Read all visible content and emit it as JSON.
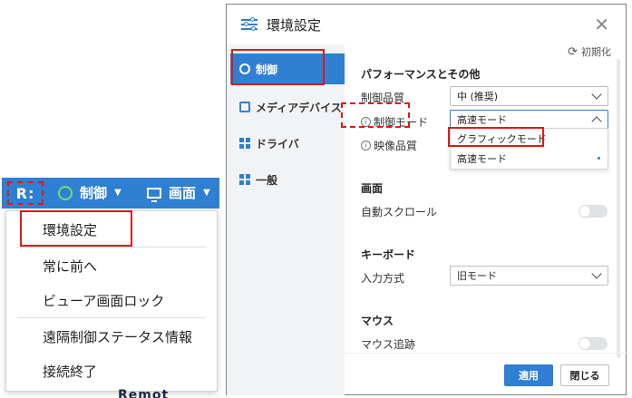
{
  "toolbar": {
    "logo": "R:",
    "control_label": "制御",
    "screen_label": "画面"
  },
  "context_menu": {
    "items": [
      {
        "label": "環境設定"
      },
      {
        "label": "常に前へ"
      },
      {
        "label": "ビューア画面ロック"
      },
      {
        "label": "遠隔制御ステータス情報"
      },
      {
        "label": "接続終了"
      }
    ]
  },
  "background_peek": {
    "prefix": "",
    "text": "Remot"
  },
  "dialog": {
    "title": "環境設定",
    "reset_label": "初期化",
    "sidebar": [
      {
        "label": "制御"
      },
      {
        "label": "メディアデバイス"
      },
      {
        "label": "ドライバ"
      },
      {
        "label": "一般"
      }
    ],
    "sections": {
      "performance": {
        "title": "パフォーマンスとその他",
        "control_quality": {
          "label": "制御品質",
          "value": "中 (推奨)"
        },
        "control_mode": {
          "label": "制御モード",
          "value": "高速モード"
        },
        "video_quality": {
          "label": "映像品質"
        },
        "mode_options": [
          "グラフィックモード",
          "高速モード"
        ]
      },
      "screen": {
        "title": "画面",
        "auto_scroll": {
          "label": "自動スクロール"
        }
      },
      "keyboard": {
        "title": "キーボード",
        "input_method": {
          "label": "入力方式",
          "value": "旧モード"
        }
      },
      "mouse": {
        "title": "マウス",
        "mouse_tracking": {
          "label": "マウス追跡"
        }
      }
    },
    "buttons": {
      "apply": "適用",
      "close": "閉じる"
    }
  },
  "colors": {
    "accent": "#2f7fd2",
    "highlight": "#e01818"
  }
}
